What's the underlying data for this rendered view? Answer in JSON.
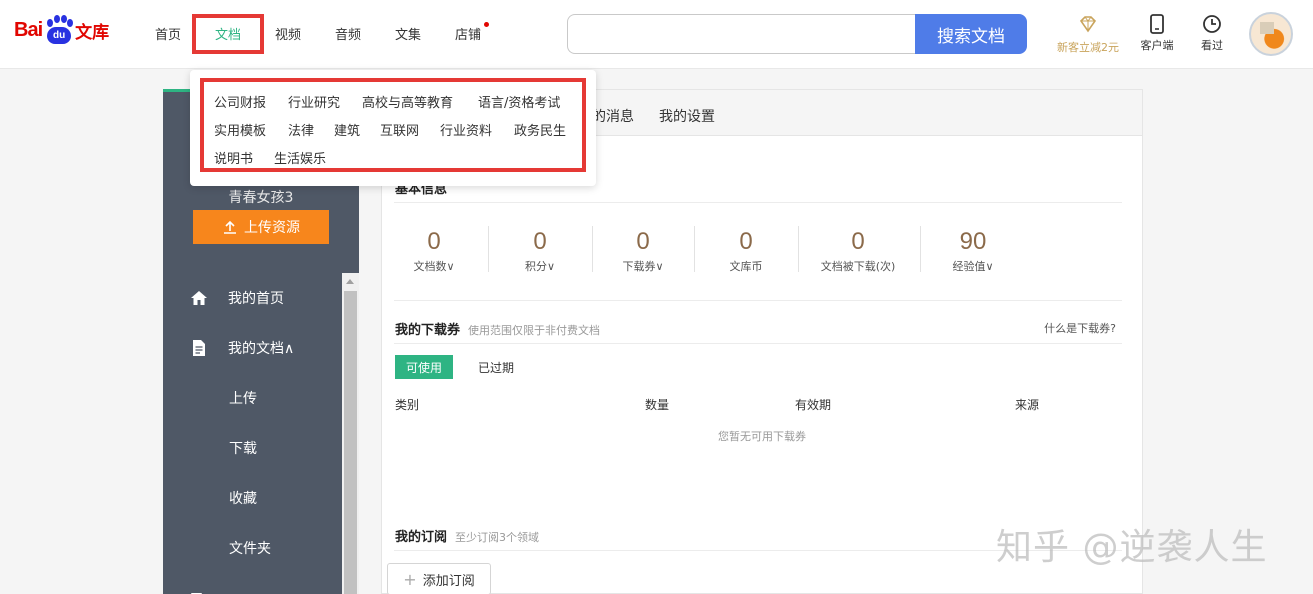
{
  "logo": {
    "bai": "Bai",
    "du": "du",
    "wenku": "文库"
  },
  "nav": {
    "items": [
      {
        "label": "首页",
        "active": false
      },
      {
        "label": "文档",
        "active": true
      },
      {
        "label": "视频",
        "active": false
      },
      {
        "label": "音频",
        "active": false
      },
      {
        "label": "文集",
        "active": false
      },
      {
        "label": "店铺",
        "active": false,
        "has_dot": true
      }
    ]
  },
  "search": {
    "value": "",
    "placeholder": "",
    "button_label": "搜索文档"
  },
  "header_right": {
    "promo_label": "新客立减2元",
    "client_label": "客户端",
    "history_label": "看过"
  },
  "dropdown": {
    "rows": [
      [
        "公司财报",
        "行业研究",
        "高校与高等教育",
        "语言/资格考试"
      ],
      [
        "实用模板",
        "法律",
        "建筑",
        "互联网",
        "行业资料",
        "政务民生"
      ],
      [
        "说明书",
        "生活娱乐"
      ]
    ]
  },
  "sidebar": {
    "username": "青春女孩3",
    "upload_label": "上传资源",
    "menu": [
      {
        "label": "我的首页",
        "icon": "home-icon"
      },
      {
        "label": "我的文档∧",
        "icon": "document-icon"
      },
      {
        "label": "上传"
      },
      {
        "label": "下载"
      },
      {
        "label": "收藏"
      },
      {
        "label": "文件夹"
      }
    ]
  },
  "main": {
    "tabs": [
      "的消息",
      "我的设置"
    ],
    "basic_info_title": "基本信息",
    "stats": [
      {
        "value": "0",
        "label": "文档数∨"
      },
      {
        "value": "0",
        "label": "积分∨"
      },
      {
        "value": "0",
        "label": "下载券∨"
      },
      {
        "value": "0",
        "label": "文库币"
      },
      {
        "value": "0",
        "label": "文档被下载(次)"
      },
      {
        "value": "90",
        "label": "经验值∨"
      }
    ],
    "coupons": {
      "title": "我的下载券",
      "note": "使用范围仅限于非付费文档",
      "help_link": "什么是下载券?",
      "tab_active": "可使用",
      "tab_inactive": "已过期",
      "columns": [
        "类别",
        "数量",
        "有效期",
        "来源"
      ],
      "empty_text": "您暂无可用下载券"
    },
    "subscription": {
      "title": "我的订阅",
      "note": "至少订阅3个领域",
      "add_label": "添加订阅"
    }
  },
  "watermark": "知乎 @逆袭人生",
  "colors": {
    "accent_green": "#2eb483",
    "brand_red": "#e10601",
    "search_blue": "#4f7ce8",
    "upload_orange": "#f7861c",
    "highlight_red": "#e53935"
  }
}
